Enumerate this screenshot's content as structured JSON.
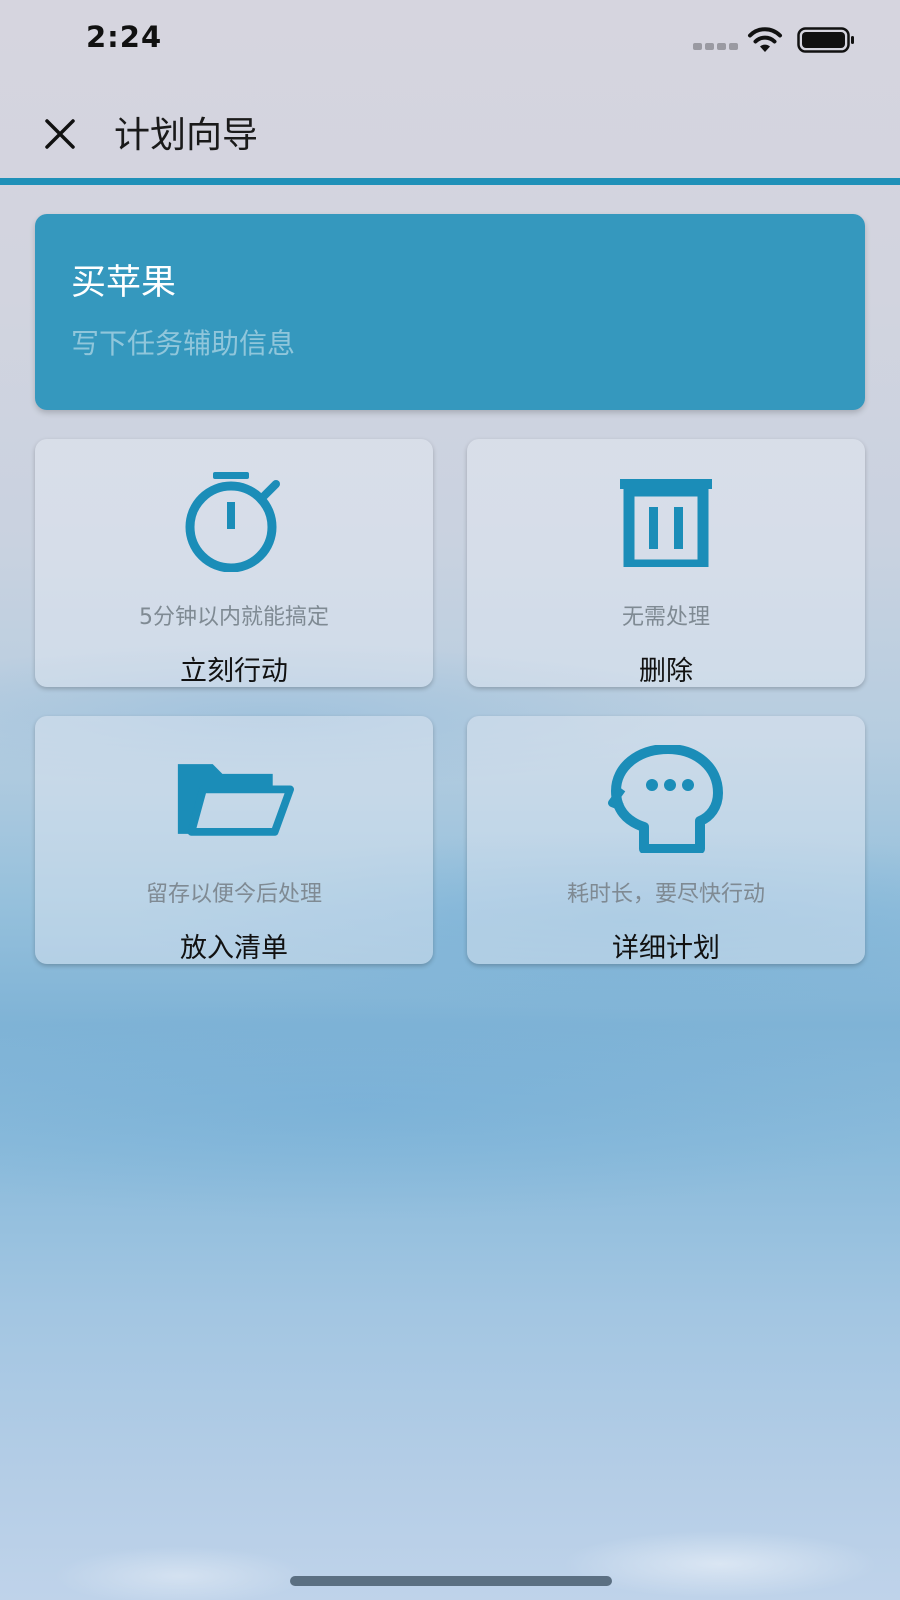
{
  "status_bar": {
    "time": "2:24"
  },
  "header": {
    "title": "计划向导"
  },
  "task": {
    "title": "买苹果",
    "note_placeholder": "写下任务辅助信息"
  },
  "actions": [
    {
      "icon": "stopwatch-icon",
      "description": "5分钟以内就能搞定",
      "label": "立刻行动"
    },
    {
      "icon": "trash-icon",
      "description": "无需处理",
      "label": "删除"
    },
    {
      "icon": "folder-open-icon",
      "description": "留存以便今后处理",
      "label": "放入清单"
    },
    {
      "icon": "head-thinking-icon",
      "description": "耗时长，要尽快行动",
      "label": "详细计划"
    }
  ],
  "colors": {
    "accent": "#1f90b8",
    "card": "#3598be",
    "icon": "#1b8db8"
  }
}
